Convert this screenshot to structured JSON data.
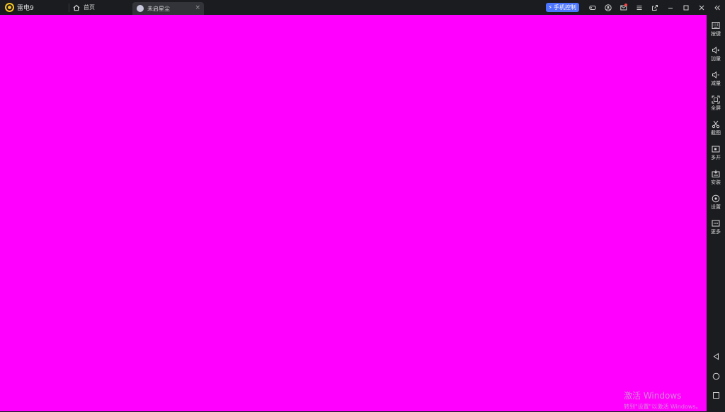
{
  "app": {
    "title": "雷电9"
  },
  "tabs": [
    {
      "label": "首页"
    },
    {
      "label": "未启星尘",
      "close": "×"
    }
  ],
  "header": {
    "phone_control_label": "手机控制",
    "controls": [
      "gamepad-icon",
      "user-icon",
      "mail-icon",
      "menu-icon",
      "popout-icon",
      "minimize-icon",
      "maximize-icon",
      "close-icon",
      "collapse-icon"
    ]
  },
  "screen": {
    "background": "#ff00ff"
  },
  "sidebar": {
    "items": [
      {
        "label": "按键",
        "icon": "keyboard-icon"
      },
      {
        "label": "加量",
        "icon": "volume-up-icon"
      },
      {
        "label": "减量",
        "icon": "volume-down-icon"
      },
      {
        "label": "全屏",
        "icon": "fullscreen-icon"
      },
      {
        "label": "截图",
        "icon": "scissors-icon"
      },
      {
        "label": "多开",
        "icon": "multi-instance-icon"
      },
      {
        "label": "安装",
        "icon": "apk-install-icon"
      },
      {
        "label": "设置",
        "icon": "settings-icon"
      },
      {
        "label": "更多",
        "icon": "more-icon"
      }
    ],
    "nav": [
      "back-icon",
      "home-icon",
      "recents-icon"
    ]
  },
  "watermark": {
    "line1": "激活 Windows",
    "line2": "转到\"设置\"以激活 Windows。"
  },
  "colors": {
    "accent": "#4b74ff",
    "logo": "#f6c624",
    "chrome": "#1b1c20"
  }
}
